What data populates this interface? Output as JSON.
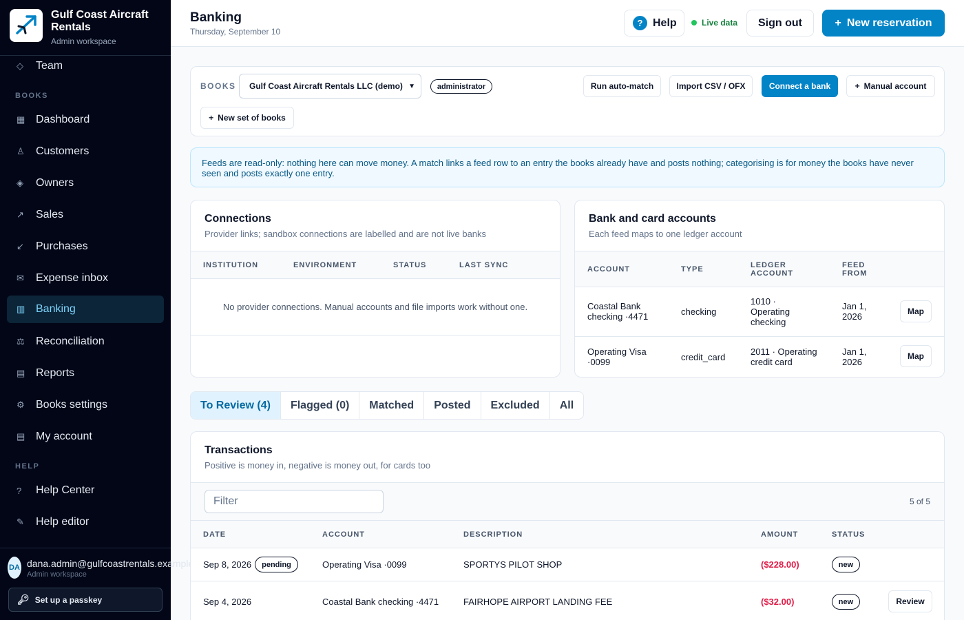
{
  "brand": {
    "name": "Gulf Coast Aircraft Rentals",
    "workspace": "Admin workspace"
  },
  "sidebar": {
    "top_items": [
      {
        "label": "Team",
        "icon": "diamond-outline-icon"
      }
    ],
    "books_section": "BOOKS",
    "books_items": [
      {
        "label": "Dashboard",
        "icon": "grid-icon"
      },
      {
        "label": "Customers",
        "icon": "person-icon"
      },
      {
        "label": "Owners",
        "icon": "diamond-icon"
      },
      {
        "label": "Sales",
        "icon": "arrow-up-right-icon"
      },
      {
        "label": "Purchases",
        "icon": "arrow-down-left-icon"
      },
      {
        "label": "Expense inbox",
        "icon": "envelope-icon"
      },
      {
        "label": "Banking",
        "icon": "bank-icon"
      },
      {
        "label": "Reconciliation",
        "icon": "scales-icon"
      },
      {
        "label": "Reports",
        "icon": "document-icon"
      },
      {
        "label": "Books settings",
        "icon": "gear-icon"
      },
      {
        "label": "My account",
        "icon": "list-icon"
      }
    ],
    "help_section": "HELP",
    "help_items": [
      {
        "label": "Help Center",
        "icon": "question-icon"
      },
      {
        "label": "Help editor",
        "icon": "pencil-icon"
      }
    ],
    "active": "Banking",
    "user": {
      "initials": "DA",
      "email": "dana.admin@gulfcoastrentals.example",
      "role": "Admin workspace"
    },
    "passkey_label": "Set up a passkey"
  },
  "header": {
    "title": "Banking",
    "date": "Thursday, September 10",
    "help_label": "Help",
    "live_label": "Live data",
    "signout_label": "Sign out",
    "new_reservation_label": "New reservation"
  },
  "books_bar": {
    "label": "BOOKS",
    "selected_books": "Gulf Coast Aircraft Rentals LLC (demo)",
    "role_badge": "administrator",
    "run_auto_match": "Run auto-match",
    "import_csv": "Import CSV / OFX",
    "connect_bank": "Connect a bank",
    "manual_account": "Manual account",
    "new_books": "New set of books"
  },
  "info_banner": "Feeds are read-only: nothing here can move money. A match links a feed row to an entry the books already have and posts nothing; categorising is for money the books have never seen and posts exactly one entry.",
  "connections": {
    "title": "Connections",
    "subtitle": "Provider links; sandbox connections are labelled and are not live banks",
    "columns": [
      "INSTITUTION",
      "ENVIRONMENT",
      "STATUS",
      "LAST SYNC"
    ],
    "empty": "No provider connections. Manual accounts and file imports work without one."
  },
  "accounts": {
    "title": "Bank and card accounts",
    "subtitle": "Each feed maps to one ledger account",
    "columns": [
      "ACCOUNT",
      "TYPE",
      "LEDGER ACCOUNT",
      "FEED FROM"
    ],
    "rows": [
      {
        "account": "Coastal Bank checking ·4471",
        "type": "checking",
        "ledger": "1010 · Operating checking",
        "feed_from": "Jan 1, 2026",
        "action": "Map"
      },
      {
        "account": "Operating Visa ·0099",
        "type": "credit_card",
        "ledger": "2011 · Operating credit card",
        "feed_from": "Jan 1, 2026",
        "action": "Map"
      }
    ]
  },
  "tabs": [
    {
      "label": "To Review (4)",
      "active": true
    },
    {
      "label": "Flagged (0)",
      "active": false
    },
    {
      "label": "Matched",
      "active": false
    },
    {
      "label": "Posted",
      "active": false
    },
    {
      "label": "Excluded",
      "active": false
    },
    {
      "label": "All",
      "active": false
    }
  ],
  "transactions": {
    "title": "Transactions",
    "subtitle": "Positive is money in, negative is money out, for cards too",
    "filter_placeholder": "Filter",
    "count": "5 of 5",
    "columns": [
      "DATE",
      "ACCOUNT",
      "DESCRIPTION",
      "AMOUNT",
      "STATUS"
    ],
    "rows": [
      {
        "date": "Sep 8, 2026",
        "date_badge": "pending",
        "account": "Operating Visa ·0099",
        "description": "SPORTYS PILOT SHOP",
        "amount": "($228.00)",
        "status": "new",
        "action": ""
      },
      {
        "date": "Sep 4, 2026",
        "date_badge": "",
        "account": "Coastal Bank checking ·4471",
        "description": "FAIRHOPE AIRPORT LANDING FEE",
        "amount": "($32.00)",
        "status": "new",
        "action": "Review"
      }
    ]
  },
  "colors": {
    "accent": "#0284c7",
    "sidebar_bg": "#020617",
    "negative_amount": "#e11d48",
    "live": "#22c55e"
  }
}
